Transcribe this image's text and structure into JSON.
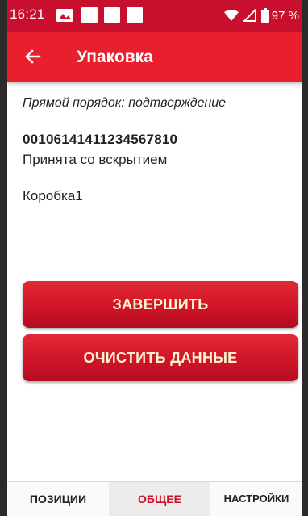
{
  "status_bar": {
    "time": "16:21",
    "battery": "97 %"
  },
  "app_bar": {
    "title": "Упаковка",
    "back_icon": "arrow-left-icon"
  },
  "content": {
    "order_line": "Прямой порядок: подтверждение",
    "code": "00106141411234567810",
    "status": "Принята со вскрытием",
    "box_name": "Коробка1"
  },
  "buttons": {
    "finish": "ЗАВЕРШИТЬ",
    "clear": "ОЧИСТИТЬ ДАННЫЕ"
  },
  "tabs": [
    {
      "label": "ПОЗИЦИИ",
      "active": false
    },
    {
      "label": "ОБЩЕЕ",
      "active": true
    },
    {
      "label": "НАСТРОЙКИ",
      "active": false
    }
  ],
  "colors": {
    "status_bar": "#c8102e",
    "app_bar": "#e8202d",
    "button": "#d0142a",
    "button_text": "#fff5c8",
    "active_tab_text": "#d0102a"
  }
}
